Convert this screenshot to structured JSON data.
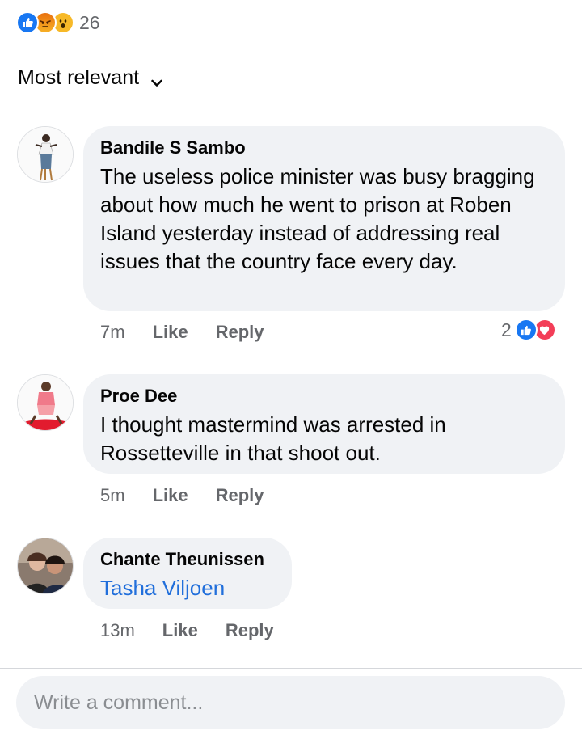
{
  "reactions": {
    "icons": [
      "like-icon",
      "angry-icon",
      "wow-icon"
    ],
    "count": "26"
  },
  "sort": {
    "label": "Most relevant"
  },
  "comments": [
    {
      "author": "Bandile S Sambo",
      "text": "The useless police minister was busy bragging about how much he went to prison at Roben Island yesterday instead of addressing real issues that the country face every day.",
      "time": "7m",
      "like_label": "Like",
      "reply_label": "Reply",
      "reaction_count": "2",
      "reaction_icons": [
        "like-icon",
        "love-icon"
      ]
    },
    {
      "author": "Proe Dee",
      "text": "I thought mastermind was arrested in Rossetteville  in that shoot out.",
      "time": "5m",
      "like_label": "Like",
      "reply_label": "Reply"
    },
    {
      "author": "Chante Theunissen",
      "text": "Tasha Viljoen",
      "time": "13m",
      "like_label": "Like",
      "reply_label": "Reply"
    }
  ],
  "composer": {
    "placeholder": "Write a comment..."
  },
  "colors": {
    "bubble": "#f0f2f5",
    "link": "#216fdb",
    "like_blue": "#1877f2",
    "love_red": "#f33e58",
    "muted_text": "#65676b"
  }
}
